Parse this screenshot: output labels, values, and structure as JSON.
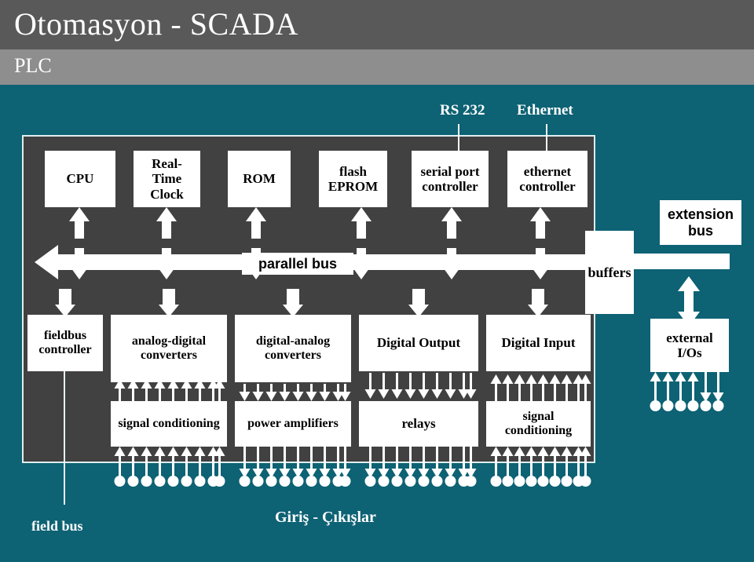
{
  "header": {
    "title": "Otomasyon - SCADA",
    "subtitle": "PLC",
    "title_band_color": "#595959",
    "subtitle_band_color": "#8e8e8e",
    "canvas_color": "#0d6274"
  },
  "diagram": {
    "panel_color": "#414141",
    "box_color": "#ffffff",
    "arrow_color": "#ffffff",
    "top_labels": [
      {
        "id": "rs232",
        "text": "RS 232"
      },
      {
        "id": "ethernet",
        "text": "Ethernet"
      }
    ],
    "row1_boxes": [
      {
        "id": "cpu",
        "text": "CPU"
      },
      {
        "id": "real-time-clock",
        "text": "Real-Time Clock"
      },
      {
        "id": "rom",
        "text": "ROM"
      },
      {
        "id": "flash-eprom",
        "text": "flash EPROM"
      },
      {
        "id": "serial-port-controller",
        "text": "serial port controller"
      },
      {
        "id": "ethernet-controller",
        "text": "ethernet controller"
      }
    ],
    "bus": {
      "parallel_bus_label": "parallel bus",
      "buffers_label": "buffers",
      "extension_bus_label": "extension bus"
    },
    "row2_boxes": [
      {
        "id": "fieldbus-controller",
        "text": "fieldbus controller"
      },
      {
        "id": "analog-digital-converters",
        "text": "analog-digital converters"
      },
      {
        "id": "digital-analog-converters",
        "text": "digital-analog converters"
      },
      {
        "id": "digital-output",
        "text": "Digital Output"
      },
      {
        "id": "digital-input",
        "text": "Digital Input"
      },
      {
        "id": "external-ios",
        "text": "external I/Os"
      }
    ],
    "row3_boxes": [
      {
        "id": "signal-conditioning-in",
        "text": "signal conditioning"
      },
      {
        "id": "power-amplifiers",
        "text": "power amplifiers"
      },
      {
        "id": "relays",
        "text": "relays"
      },
      {
        "id": "signal-conditioning-out",
        "text": "signal conditioning"
      }
    ],
    "bottom_labels": [
      {
        "id": "field-bus",
        "text": "field bus"
      },
      {
        "id": "giris-cikislar",
        "text": "Giriş - Çıkışlar"
      }
    ]
  }
}
